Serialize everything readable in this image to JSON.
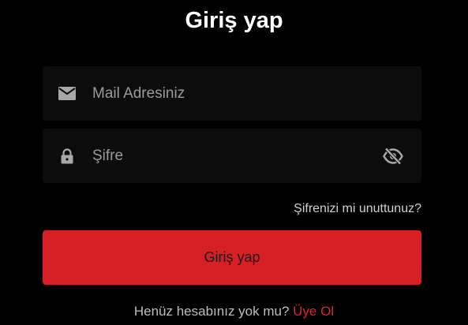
{
  "header": {
    "title": "Giriş yap"
  },
  "form": {
    "email": {
      "placeholder": "Mail Adresiniz",
      "value": "",
      "icon": "mail-icon"
    },
    "password": {
      "placeholder": "Şifre",
      "value": "",
      "icon": "lock-icon",
      "toggle_icon": "eye-off-icon"
    },
    "forgot_label": "Şifrenizi mi unuttunuz?",
    "submit_label": "Giriş yap"
  },
  "footer": {
    "prompt": "Henüz hesabınız yok mu?",
    "signup_label": "Üye Ol"
  },
  "colors": {
    "background": "#000000",
    "field": "#0c0c0c",
    "accent": "#d71f26",
    "link": "#e52229"
  }
}
